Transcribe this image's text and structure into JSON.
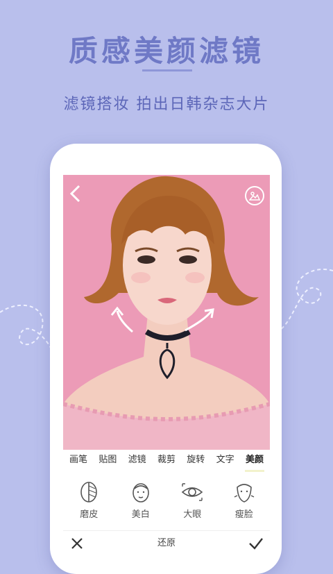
{
  "promo": {
    "headline": "质感美颜滤镜",
    "subtitle": "滤镜搭妆  拍出日韩杂志大片"
  },
  "editor": {
    "back_icon": "chevron-left-icon",
    "gallery_icon": "image-icon",
    "tabs": [
      {
        "label": "画笔",
        "active": false
      },
      {
        "label": "贴图",
        "active": false
      },
      {
        "label": "滤镜",
        "active": false
      },
      {
        "label": "裁剪",
        "active": false
      },
      {
        "label": "旋转",
        "active": false
      },
      {
        "label": "文字",
        "active": false
      },
      {
        "label": "美颜",
        "active": true
      }
    ],
    "beauty_tools": [
      {
        "label": "磨皮",
        "icon": "smooth-skin-icon"
      },
      {
        "label": "美白",
        "icon": "whiten-face-icon"
      },
      {
        "label": "大眼",
        "icon": "big-eye-icon"
      },
      {
        "label": "瘦脸",
        "icon": "slim-face-icon"
      }
    ],
    "bottom_bar": {
      "cancel_icon": "close-icon",
      "undo_label": "还原",
      "confirm_icon": "check-icon"
    }
  },
  "colors": {
    "background": "#b9bfec",
    "headline": "#6f79c6",
    "photo_backdrop": "#ec9bb7"
  }
}
